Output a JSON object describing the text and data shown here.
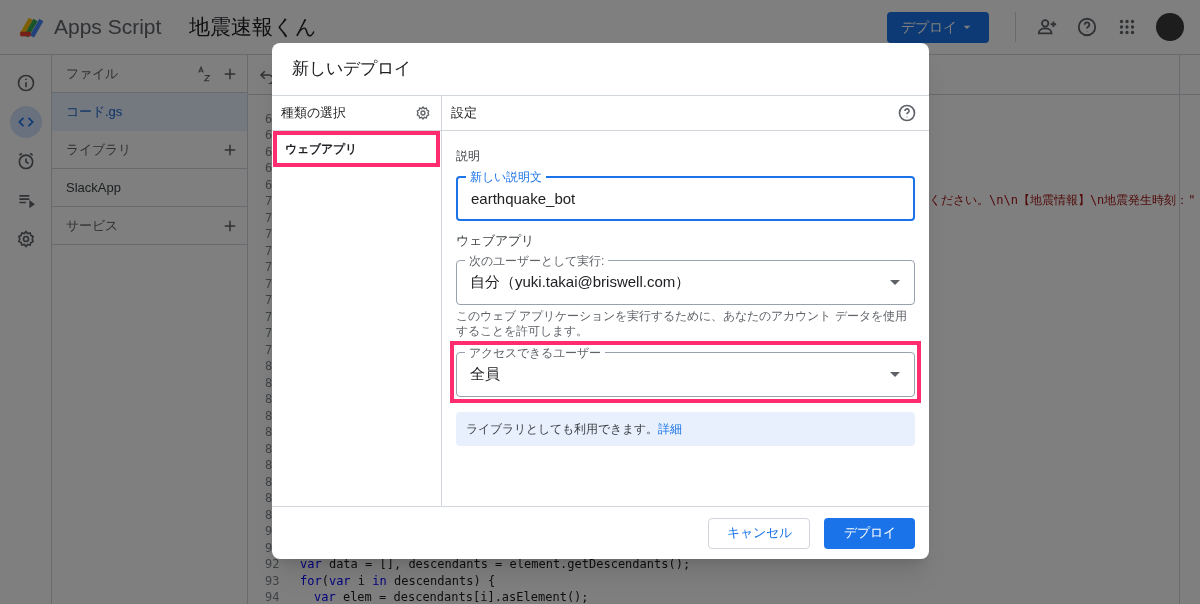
{
  "app_bar": {
    "product": "Apps Script",
    "project_title": "地震速報くん",
    "deploy_button": "デプロイ"
  },
  "rail": [
    {
      "selected": false
    },
    {
      "selected": true
    },
    {
      "selected": false
    },
    {
      "selected": false
    },
    {
      "selected": false
    }
  ],
  "files_panel": {
    "sections": [
      {
        "title": "ファイル",
        "items": [
          {
            "label": "コード.gs",
            "selected": true
          }
        ]
      },
      {
        "title": "ライブラリ",
        "items": [
          {
            "label": "SlackApp",
            "selected": false
          }
        ]
      },
      {
        "title": "サービス"
      }
    ]
  },
  "editor": {
    "gutter": [
      "6",
      "6",
      "6",
      "6",
      "6",
      "7",
      "7",
      "7",
      "7",
      "7",
      "7",
      "7",
      "7",
      "7",
      "7",
      "8",
      "8",
      "8",
      "8",
      "8",
      "8",
      "8",
      "8",
      "8",
      "8",
      "9",
      "9",
      "92",
      "93",
      "94"
    ],
    "visible_code": [
      {
        "text": "ください。\\n\\n【地震情報】\\n地震発生時刻：\"",
        "kind": "string"
      }
    ],
    "bottom_code": [
      {
        "tokens": [
          {
            "text": "var",
            "kind": "keyword"
          },
          {
            "text": " data = [], descendants = element.getDescendants();",
            "kind": "plain"
          }
        ]
      },
      {
        "tokens": [
          {
            "text": "for",
            "kind": "keyword"
          },
          {
            "text": "(",
            "kind": "plain"
          },
          {
            "text": "var",
            "kind": "keyword"
          },
          {
            "text": " i ",
            "kind": "plain"
          },
          {
            "text": "in",
            "kind": "keyword"
          },
          {
            "text": " descendants) {",
            "kind": "plain"
          }
        ],
        "children": [
          {
            "tokens": [
              {
                "text": "var",
                "kind": "keyword"
              },
              {
                "text": " elem = descendants[i].asElement();",
                "kind": "plain"
              }
            ]
          }
        ]
      }
    ]
  },
  "dialog": {
    "title": "新しいデプロイ",
    "type_panel": {
      "heading": "種類の選択",
      "types": [
        {
          "label": "ウェブアプリ",
          "selected": true,
          "highlighted": true
        }
      ]
    },
    "settings": {
      "heading": "設定",
      "description_label": "説明",
      "description_field": {
        "label": "新しい説明文",
        "value": "earthquake_bot",
        "focused": true
      },
      "section_heading": "ウェブアプリ",
      "execute_as": {
        "label": "次のユーザーとして実行:",
        "value": "自分（yuki.takai@briswell.com）"
      },
      "execute_help": "このウェブ アプリケーションを実行するために、あなたのアカウント データを使用することを許可します。",
      "access": {
        "label": "アクセスできるユーザー",
        "value": "全員",
        "highlighted": true
      },
      "info": {
        "text": "ライブラリとしても利用できます。",
        "link": "詳細"
      }
    },
    "buttons": [
      {
        "label": "キャンセル",
        "kind": "secondary"
      },
      {
        "label": "デプロイ",
        "kind": "primary"
      }
    ]
  }
}
